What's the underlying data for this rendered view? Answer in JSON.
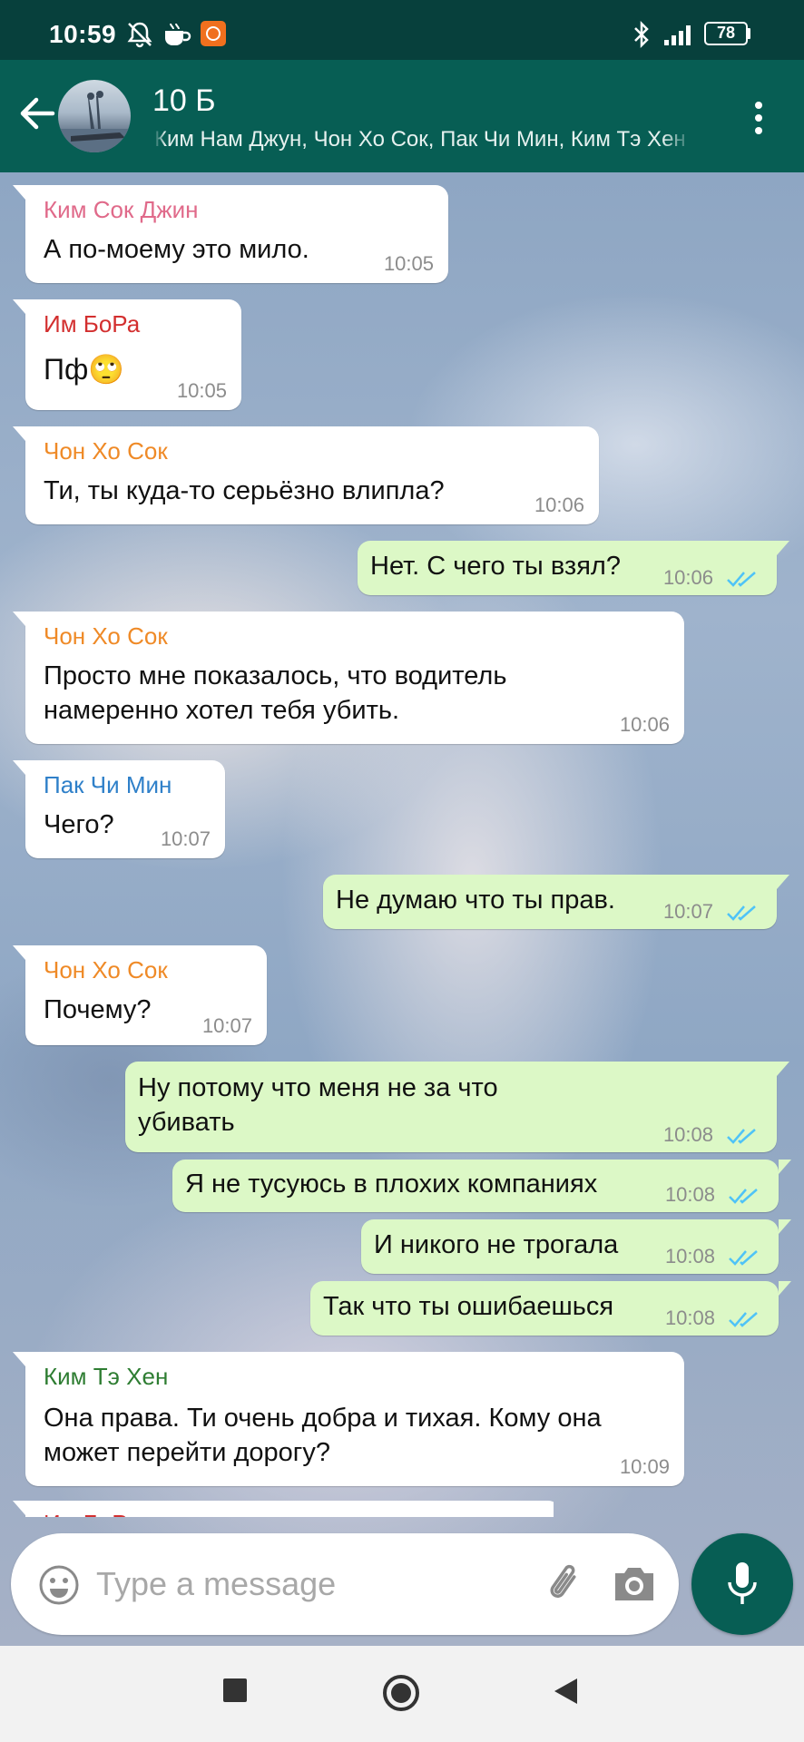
{
  "status_bar": {
    "time": "10:59",
    "battery": "78"
  },
  "header": {
    "title": "10 Б",
    "members": "Ким Нам Джун, Чон Хо Сок, Пак Чи Мин, Ким Тэ Хен"
  },
  "colors": {
    "header": "#075e54",
    "status_bar": "#07403c",
    "outgoing_bubble": "#dcf8c6",
    "incoming_bubble": "#ffffff",
    "read_ticks": "#4fc3f7",
    "sender_kim_sok_jin": "#e06a8a",
    "sender_im_bora": "#d32f2f",
    "sender_chon_ho_sok": "#ef8a27",
    "sender_pak_chi_min": "#2f80c9",
    "sender_kim_te_hen": "#2e7d32"
  },
  "messages": [
    {
      "sender": "Ким Сок Джин",
      "text": "А по-моему это мило.",
      "time": "10:05"
    },
    {
      "sender": "Им БоРа",
      "text": "Пф🙄",
      "time": "10:05"
    },
    {
      "sender": "Чон Хо Сок",
      "text": "Ти, ты куда-то серьёзно влипла?",
      "time": "10:06"
    },
    {
      "text": "Нет. С чего ты взял?",
      "time": "10:06"
    },
    {
      "sender": "Чон Хо Сок",
      "line1": "Просто мне показалось, что водитель",
      "line2": "намеренно хотел тебя убить.",
      "time": "10:06"
    },
    {
      "sender": "Пак Чи Мин",
      "text": "Чего?",
      "time": "10:07"
    },
    {
      "text": "Не думаю что ты прав.",
      "time": "10:07"
    },
    {
      "sender": "Чон Хо Сок",
      "text": "Почему?",
      "time": "10:07"
    },
    {
      "line1": "Ну потому что меня не за что",
      "line2": "убивать",
      "time": "10:08"
    },
    {
      "text": "Я не тусуюсь в плохих компаниях",
      "time": "10:08"
    },
    {
      "text": "И никого не трогала",
      "time": "10:08"
    },
    {
      "text": "Так что ты ошибаешься",
      "time": "10:08"
    },
    {
      "sender": "Ким Тэ Хен",
      "line1": "Она права. Ти очень добра и тихая. Кому она",
      "line2": "может перейти дорогу?",
      "time": "10:09"
    },
    {
      "sender": "Им БоРа"
    }
  ],
  "input": {
    "placeholder": "Type a message",
    "value": ""
  },
  "icons": {
    "back": "arrow-left-icon",
    "menu": "more-vert-icon",
    "emoji": "emoji-icon",
    "attach": "paperclip-icon",
    "camera": "camera-icon",
    "mic": "mic-icon",
    "nav_recent": "square-icon",
    "nav_home": "circle-icon",
    "nav_back": "triangle-back-icon"
  }
}
